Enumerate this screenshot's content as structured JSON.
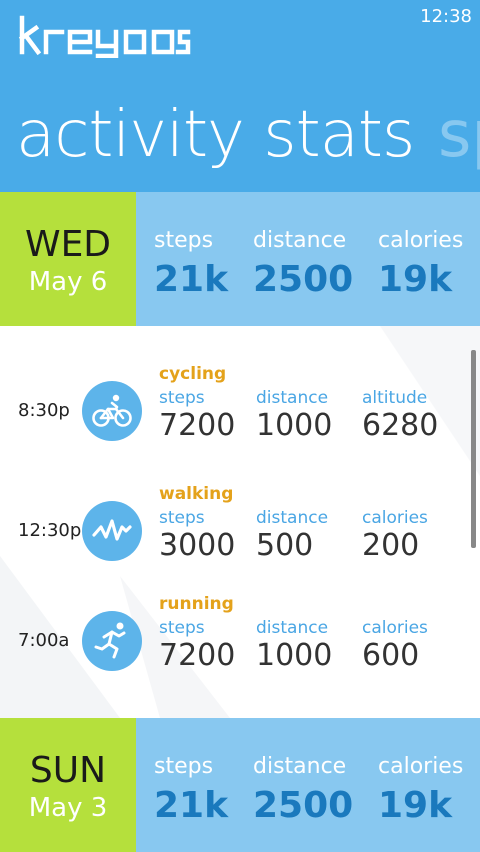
{
  "status_bar": {
    "time": "12:38"
  },
  "header": {
    "brand": "kreyos",
    "title": "activity stats",
    "next_title": "sp"
  },
  "days": [
    {
      "day": "WED",
      "date": "May 6",
      "stats": [
        {
          "label": "steps",
          "value": "21k"
        },
        {
          "label": "distance",
          "value": "2500"
        },
        {
          "label": "calories",
          "value": "19k"
        }
      ]
    },
    {
      "day": "SUN",
      "date": "May 3",
      "stats": [
        {
          "label": "steps",
          "value": "21k"
        },
        {
          "label": "distance",
          "value": "2500"
        },
        {
          "label": "calories",
          "value": "19k"
        }
      ]
    }
  ],
  "activities": [
    {
      "time": "8:30p",
      "type": "cycling",
      "icon": "cycling-icon",
      "metrics": [
        {
          "label": "steps",
          "value": "7200"
        },
        {
          "label": "distance",
          "value": "1000"
        },
        {
          "label": "altitude",
          "value": "6280"
        }
      ]
    },
    {
      "time": "12:30p",
      "type": "walking",
      "icon": "walking-wave-icon",
      "metrics": [
        {
          "label": "steps",
          "value": "3000"
        },
        {
          "label": "distance",
          "value": "500"
        },
        {
          "label": "calories",
          "value": "200"
        }
      ]
    },
    {
      "time": "7:00a",
      "type": "running",
      "icon": "running-icon",
      "metrics": [
        {
          "label": "steps",
          "value": "7200"
        },
        {
          "label": "distance",
          "value": "1000"
        },
        {
          "label": "calories",
          "value": "600"
        }
      ]
    }
  ],
  "colors": {
    "header_blue": "#49ABE8",
    "day_green": "#B5E03C",
    "stats_light_blue": "#88C8F0",
    "stat_value_blue": "#1A79BD",
    "activity_type_orange": "#E4A21B",
    "metric_label_blue": "#4AA6E4"
  }
}
